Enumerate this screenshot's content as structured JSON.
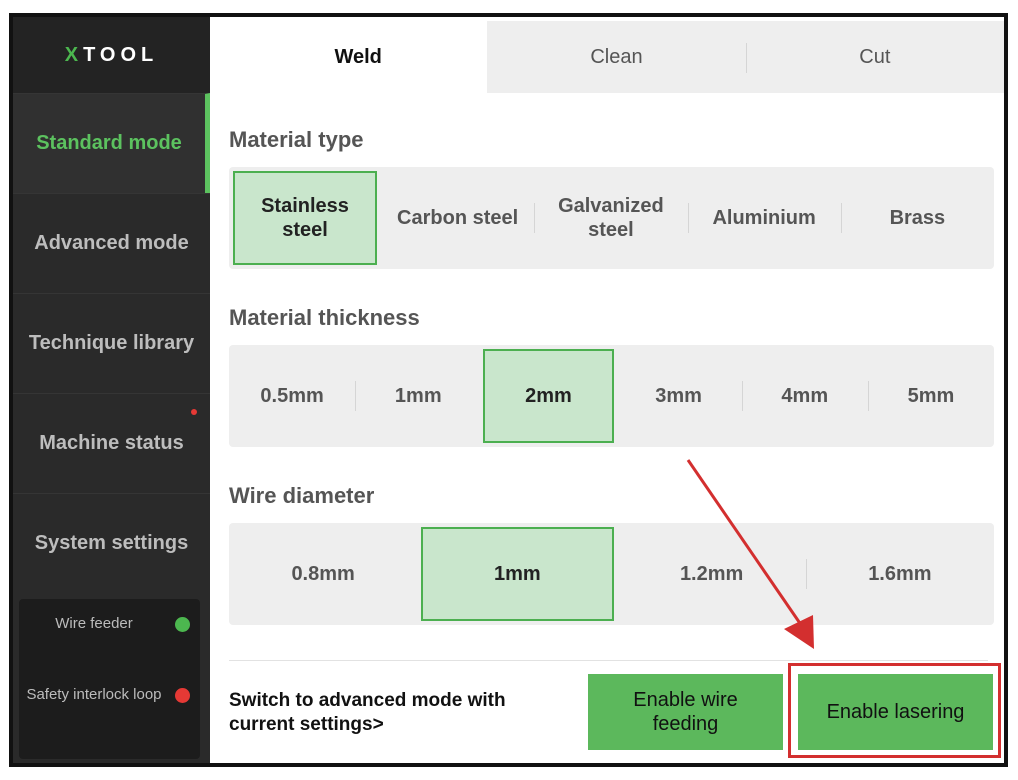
{
  "sidebar": {
    "logo": "XTOOL",
    "items": [
      {
        "label": "Standard mode",
        "active": true
      },
      {
        "label": "Advanced mode"
      },
      {
        "label": "Technique library"
      },
      {
        "label": "Machine status",
        "notification": true
      },
      {
        "label": "System settings"
      }
    ],
    "status": [
      {
        "label": "Wire feeder",
        "color": "#4caf50"
      },
      {
        "label": "Safety interlock loop",
        "color": "#e53935"
      }
    ]
  },
  "tabs": [
    "Weld",
    "Clean",
    "Cut"
  ],
  "active_tab": "Weld",
  "material_type": {
    "title": "Material type",
    "options": [
      "Stainless steel",
      "Carbon steel",
      "Galvanized steel",
      "Aluminium",
      "Brass"
    ],
    "selected": "Stainless steel"
  },
  "material_thickness": {
    "title": "Material thickness",
    "options": [
      "0.5mm",
      "1mm",
      "2mm",
      "3mm",
      "4mm",
      "5mm"
    ],
    "selected": "2mm"
  },
  "wire_diameter": {
    "title": "Wire diameter",
    "options": [
      "0.8mm",
      "1mm",
      "1.2mm",
      "1.6mm"
    ],
    "selected": "1mm"
  },
  "footer": {
    "switch_text": "Switch to advanced mode with current settings>",
    "enable_wire_feeding": "Enable wire feeding",
    "enable_lasering": "Enable lasering"
  },
  "colors": {
    "accent": "#5cb85c",
    "selected_bg": "#c9e6cc",
    "annotation": "#d32f2f"
  }
}
